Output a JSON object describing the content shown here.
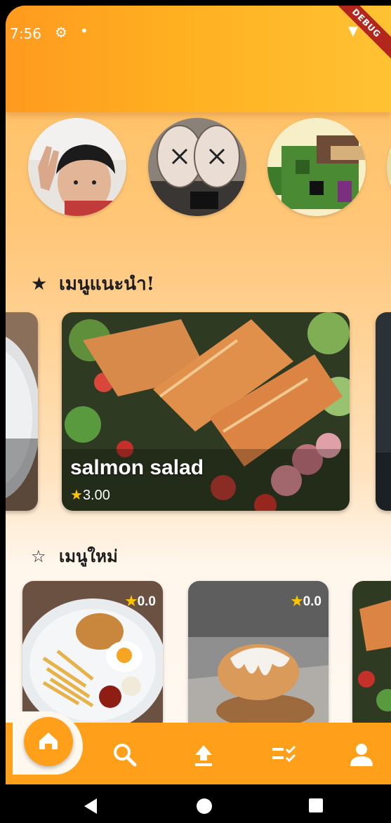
{
  "status": {
    "time": "7:56"
  },
  "debug_banner": "DEBUG",
  "recommended": {
    "title": "เมนูแนะนำ!",
    "featured": {
      "name": "salmon salad",
      "rating": "3.00"
    }
  },
  "new_menu": {
    "title": "เมนูใหม่",
    "items": [
      {
        "rating": "0.0"
      },
      {
        "rating": "0.0"
      }
    ]
  },
  "bottom_nav": {
    "items": [
      "home-icon",
      "search-icon",
      "upload-icon",
      "checklist-icon",
      "person-icon"
    ],
    "active": "home-icon"
  },
  "colors": {
    "accent": "#ff9f1a",
    "star": "#ffc400"
  }
}
